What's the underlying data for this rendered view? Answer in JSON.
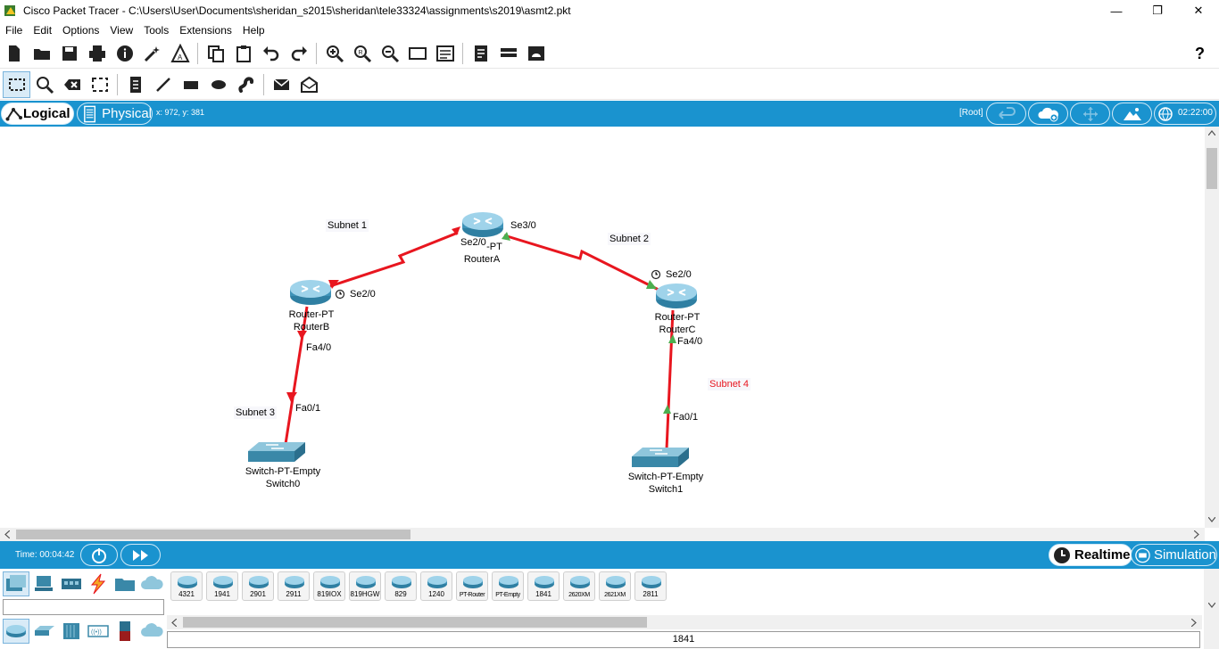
{
  "window": {
    "title": "Cisco Packet Tracer - C:\\Users\\User\\Documents\\sheridan_s2015\\sheridan\\tele33324\\assignments\\s2019\\asmt2.pkt",
    "minimize": "—",
    "restore": "❐",
    "close": "✕"
  },
  "menu": [
    {
      "label": "File"
    },
    {
      "label": "Edit"
    },
    {
      "label": "Options"
    },
    {
      "label": "View"
    },
    {
      "label": "Tools"
    },
    {
      "label": "Extensions"
    },
    {
      "label": "Help"
    }
  ],
  "toolbar1": {
    "help_label": "?",
    "icons": [
      "new-icon",
      "open-icon",
      "save-icon",
      "print-icon",
      "info-icon",
      "wizard-icon",
      "network-info-icon",
      "copy-icon",
      "paste-icon",
      "undo-icon",
      "redo-icon",
      "zoom-in-icon",
      "zoom-reset-icon",
      "zoom-out-icon",
      "drawing-palette-icon",
      "custom-devices-icon",
      "text-file-icon",
      "ipc-icon",
      "web-icon"
    ]
  },
  "toolbar2": {
    "icons": [
      "select-icon",
      "inspect-icon",
      "delete-icon",
      "resize-shape-icon",
      "place-note-icon",
      "draw-line-icon",
      "draw-rectangle-icon",
      "draw-ellipse-icon",
      "draw-freeform-icon",
      "simple-pdu-icon",
      "complex-pdu-icon"
    ]
  },
  "logicalbar": {
    "logical_label": "Logical",
    "physical_label": "Physical",
    "coords": "x: 972, y: 381",
    "root_label": "[Root]",
    "clock": "02:22:00"
  },
  "canvas": {
    "subnet_labels": [
      {
        "id": "subnet1",
        "text": "Subnet 1",
        "color": "#000000"
      },
      {
        "id": "subnet2",
        "text": "Subnet 2",
        "color": "#000000"
      },
      {
        "id": "subnet3",
        "text": "Subnet 3",
        "color": "#000000"
      },
      {
        "id": "subnet4",
        "text": "Subnet 4",
        "color": "#e8161f"
      }
    ],
    "devices": [
      {
        "id": "routerA",
        "type_label": "-PT",
        "name": "RouterA"
      },
      {
        "id": "routerB",
        "type_label": "Router-PT",
        "name": "RouterB"
      },
      {
        "id": "routerC",
        "type_label": "Router-PT",
        "name": "RouterC"
      },
      {
        "id": "switch0",
        "type_label": "Switch-PT-Empty",
        "name": "Switch0"
      },
      {
        "id": "switch1",
        "type_label": "Switch-PT-Empty",
        "name": "Switch1"
      }
    ],
    "ports": {
      "a_se20": "Se2/0",
      "a_se30": "Se3/0",
      "b_se20": "Se2/0",
      "b_fa40": "Fa4/0",
      "c_se20": "Se2/0",
      "c_fa40": "Fa4/0",
      "sw0_fa01": "Fa0/1",
      "sw1_fa01": "Fa0/1"
    },
    "link_color": "#e8161f",
    "link_up_color": "#4caf50",
    "link_down_color": "#e8161f"
  },
  "timebar": {
    "time": "Time: 00:04:42",
    "realtime_label": "Realtime",
    "simulation_label": "Simulation"
  },
  "devpanel": {
    "models": [
      "4321",
      "1941",
      "2901",
      "2911",
      "819IOX",
      "819HGW",
      "829",
      "1240",
      "PT-Router",
      "PT-Empty",
      "1841",
      "2620XM",
      "2621XM",
      "2811"
    ],
    "selected_model": "1841"
  }
}
